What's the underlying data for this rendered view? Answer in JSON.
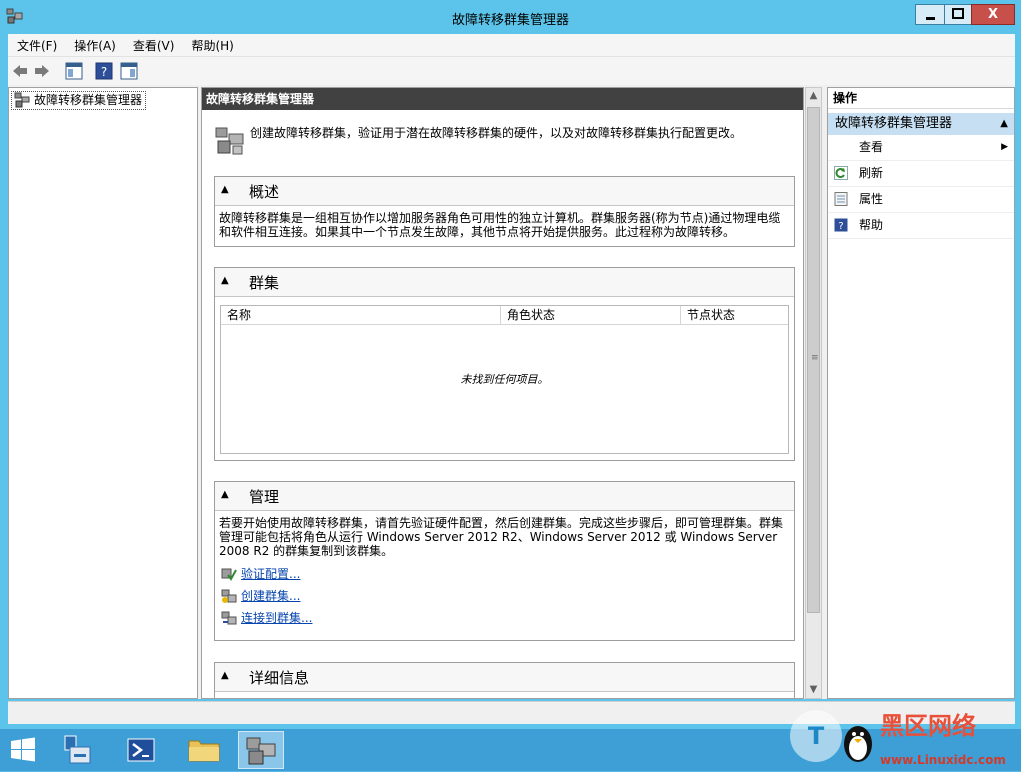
{
  "window": {
    "title": "故障转移群集管理器",
    "close_label": "X"
  },
  "menu": [
    "文件(F)",
    "操作(A)",
    "查看(V)",
    "帮助(H)"
  ],
  "tree": {
    "root": "故障转移群集管理器"
  },
  "center": {
    "header": "故障转移群集管理器",
    "intro": "创建故障转移群集，验证用于潜在故障转移群集的硬件，以及对故障转移群集执行配置更改。",
    "overview": {
      "title": "概述",
      "text": "故障转移群集是一组相互协作以增加服务器角色可用性的独立计算机。群集服务器(称为节点)通过物理电缆和软件相互连接。如果其中一个节点发生故障，其他节点将开始提供服务。此过程称为故障转移。"
    },
    "clusters": {
      "title": "群集",
      "columns": [
        "名称",
        "角色状态",
        "节点状态"
      ],
      "empty": "未找到任何项目。"
    },
    "management": {
      "title": "管理",
      "text": "若要开始使用故障转移群集，请首先验证硬件配置，然后创建群集。完成这些步骤后，即可管理群集。群集管理可能包括将角色从运行 Windows Server 2012 R2、Windows Server 2012 或 Windows Server 2008 R2 的群集复制到该群集。",
      "links": [
        "验证配置...",
        "创建群集...",
        "连接到群集..."
      ]
    },
    "details": {
      "title": "详细信息"
    }
  },
  "actions": {
    "header": "操作",
    "section": "故障转移群集管理器",
    "items": [
      "查看",
      "刷新",
      "属性",
      "帮助"
    ]
  },
  "watermark": {
    "brand": "黑区网络",
    "url": "www.Linuxidc.com"
  }
}
